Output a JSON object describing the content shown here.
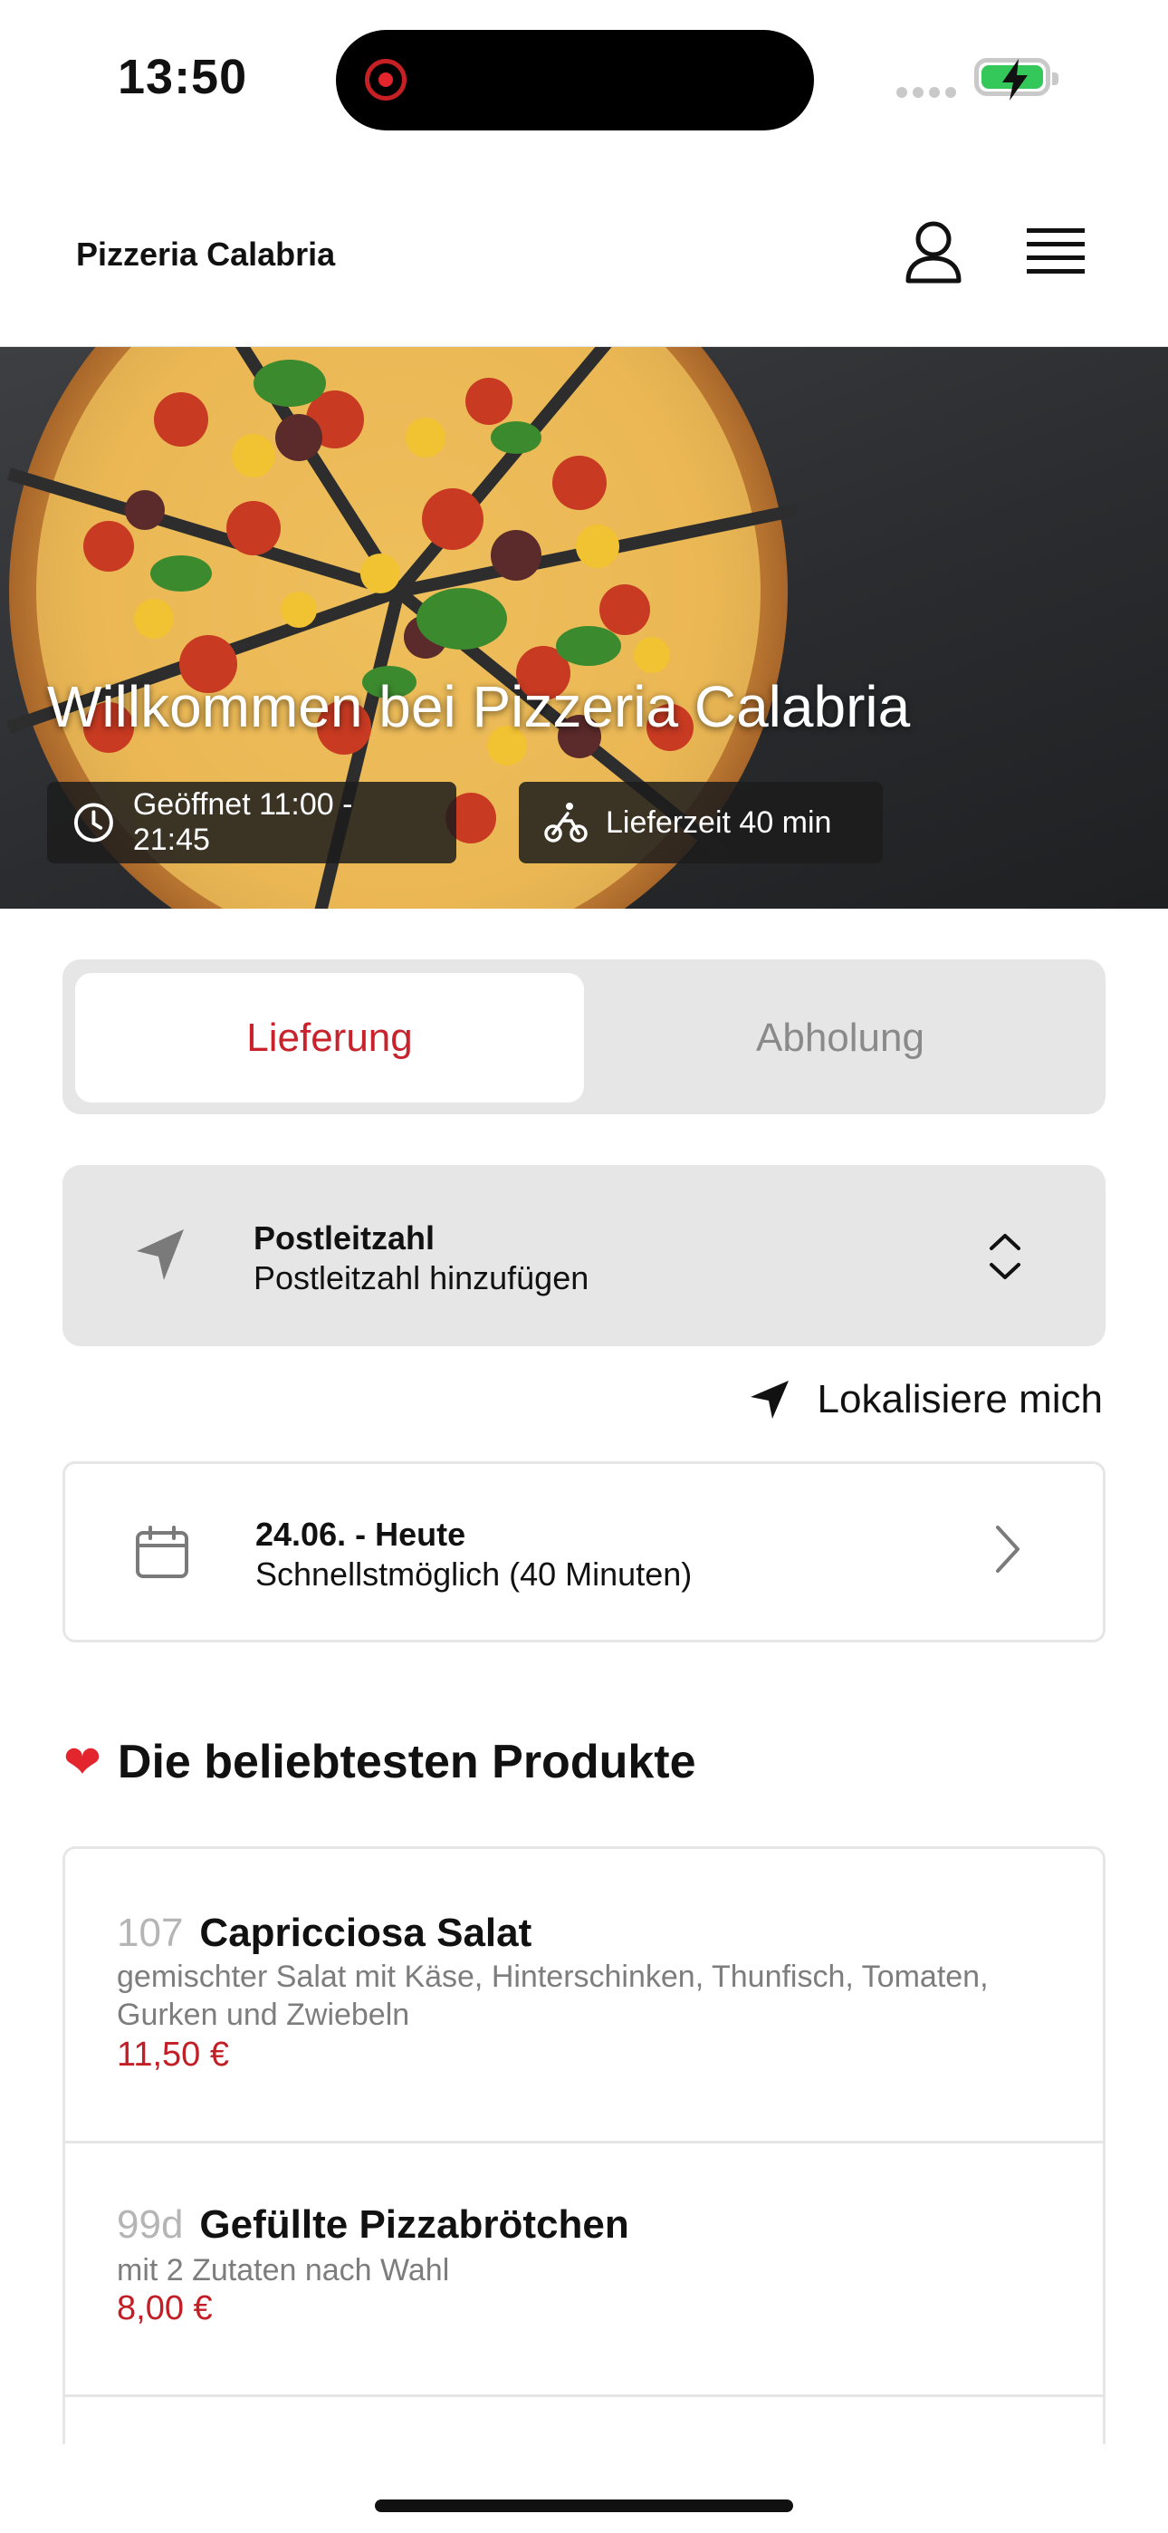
{
  "status_bar": {
    "time": "13:50"
  },
  "header": {
    "brand": "Pizzeria Calabria"
  },
  "hero": {
    "title": "Willkommen bei Pizzeria Calabria",
    "opening_hours": "Geöffnet 11:00 - 21:45",
    "delivery_time": "Lieferzeit 40 min"
  },
  "order_mode": {
    "tabs": [
      {
        "label": "Lieferung",
        "active": true
      },
      {
        "label": "Abholung",
        "active": false
      }
    ]
  },
  "postal": {
    "title": "Postleitzahl",
    "placeholder": "Postleitzahl hinzufügen"
  },
  "locate_label": "Lokalisiere mich",
  "date": {
    "title": "24.06. - Heute",
    "subtitle": "Schnellstmöglich (40 Minuten)"
  },
  "popular": {
    "title": "Die beliebtesten Produkte",
    "products": [
      {
        "number": "107",
        "name": "Capricciosa Salat",
        "description": "gemischter Salat mit Käse, Hinterschinken, Thunfisch, Tomaten, Gurken und Zwiebeln",
        "price": "11,50 €"
      },
      {
        "number": "99d",
        "name": "Gefüllte Pizzabrötchen",
        "description": "mit 2 Zutaten nach Wahl",
        "price": "8,00 €"
      }
    ]
  },
  "colors": {
    "accent": "#c8232c",
    "panel": "#e6e6e6",
    "battery": "#34c759"
  },
  "icons": [
    "user-icon",
    "menu-icon",
    "clock-icon",
    "bike-icon",
    "location-arrow-icon",
    "chevron-updown-icon",
    "calendar-icon",
    "chevron-right-icon",
    "heart-icon"
  ]
}
